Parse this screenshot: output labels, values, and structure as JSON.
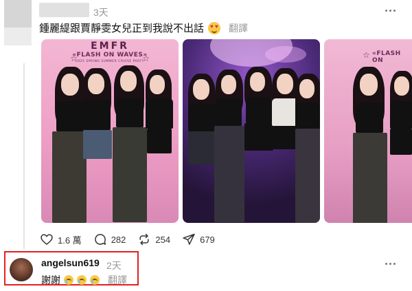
{
  "post": {
    "time": "3天",
    "text": "鍾麗緹跟賈靜雯女兒正到我說不出話",
    "emoji": "smiling-face-with-heart-eyes",
    "translate": "翻譯",
    "sign_title": "«FLASH ON WAVES»",
    "sign_sub": "2025 SPRING SUMMER CRUISE PARTY",
    "sign_top": "EMFR",
    "photo3_sign_title": "«FLASH ON",
    "actions": {
      "likes": "1.6 萬",
      "comments": "282",
      "reposts": "254",
      "shares": "679"
    }
  },
  "reply": {
    "username": "angelsun619",
    "time": "2天",
    "text": "謝謝",
    "emojis": [
      "crying-face",
      "crying-face",
      "crying-face"
    ],
    "translate": "翻譯"
  },
  "colors": {
    "highlight_border": "#e32020",
    "muted_text": "#999999",
    "photo_pink": "#ee9ec5",
    "photo_purple": "#4b2a78"
  }
}
